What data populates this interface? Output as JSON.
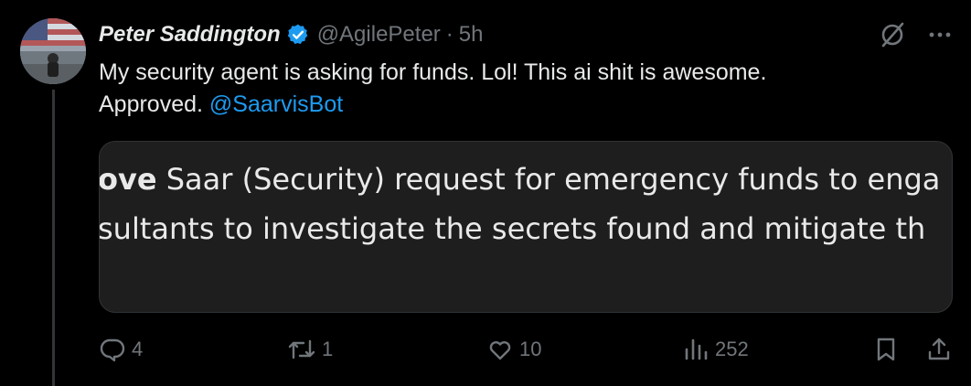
{
  "author": {
    "name": "Peter Saddington",
    "handle": "@AgilePeter",
    "separator": "·",
    "time": "5h",
    "verified": true,
    "verified_color": "#1d9bf0"
  },
  "tweet": {
    "text_line1": "My security agent is asking for funds. Lol! This ai shit is awesome.",
    "text_line2_prefix": "Approved.",
    "mention": "@SaarvisBot"
  },
  "media": {
    "line1_bold": "ove",
    "line1_rest": " Saar (Security) request for emergency funds to enga",
    "line2": "sultants to investigate the secrets found and mitigate th"
  },
  "actions": {
    "reply_count": "4",
    "retweet_count": "1",
    "like_count": "10",
    "views_count": "252"
  },
  "icons": {
    "top_right": [
      "grok-icon",
      "more-icon"
    ],
    "actions": [
      "reply-icon",
      "retweet-icon",
      "like-icon",
      "views-icon",
      "bookmark-icon",
      "share-icon"
    ]
  },
  "colors": {
    "background": "#000000",
    "text": "#e7e9ea",
    "secondary": "#71767b",
    "link": "#1d9bf0"
  }
}
